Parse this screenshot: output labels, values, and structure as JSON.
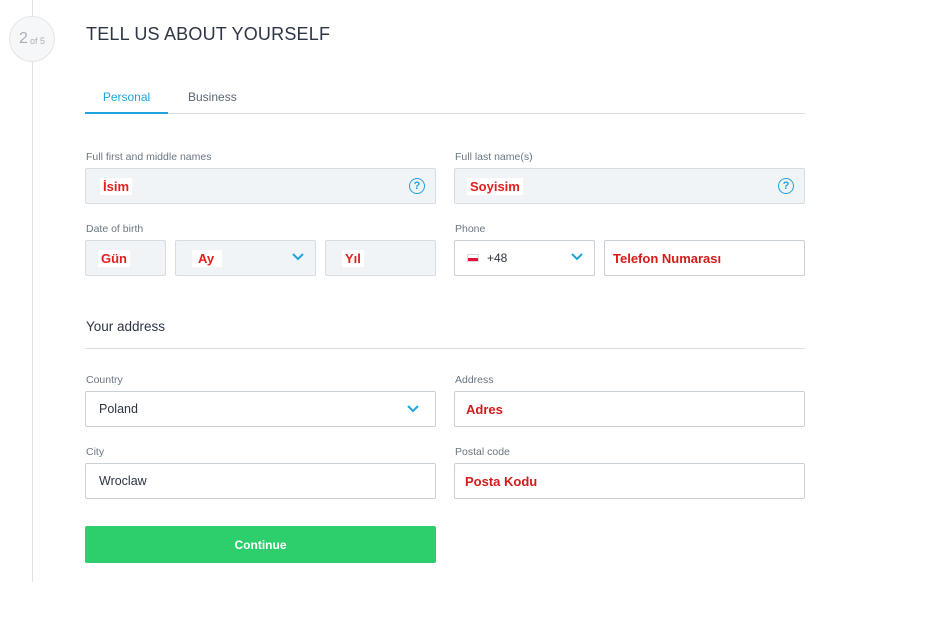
{
  "stepper": {
    "current": "2",
    "of_total": "of 5"
  },
  "page": {
    "title": "TELL US ABOUT YOURSELF"
  },
  "tabs": [
    {
      "label": "Personal",
      "active": true
    },
    {
      "label": "Business",
      "active": false
    }
  ],
  "personal": {
    "first_names": {
      "label": "Full first and middle names",
      "value": "İsim"
    },
    "last_name": {
      "label": "Full last name(s)",
      "value": "Soyisim"
    },
    "dob": {
      "label": "Date of birth",
      "day": "Gün",
      "month": "Ay",
      "year": "Yıl"
    },
    "phone": {
      "label": "Phone",
      "country_code": "+48",
      "number": "Telefon Numarası"
    }
  },
  "address": {
    "section_title": "Your address",
    "country": {
      "label": "Country",
      "value": "Poland"
    },
    "address": {
      "label": "Address",
      "value": "Adres"
    },
    "city": {
      "label": "City",
      "value": "Wroclaw"
    },
    "postal_code": {
      "label": "Postal code",
      "value": "Posta Kodu"
    }
  },
  "actions": {
    "continue_label": "Continue"
  },
  "icons": {
    "help": "question-icon",
    "dropdown": "chevron-down-icon",
    "flag": "poland-flag-icon"
  },
  "colors": {
    "accent": "#1ea4d9",
    "primary_button": "#2dcf6c",
    "annotation_red": "#e02020"
  }
}
